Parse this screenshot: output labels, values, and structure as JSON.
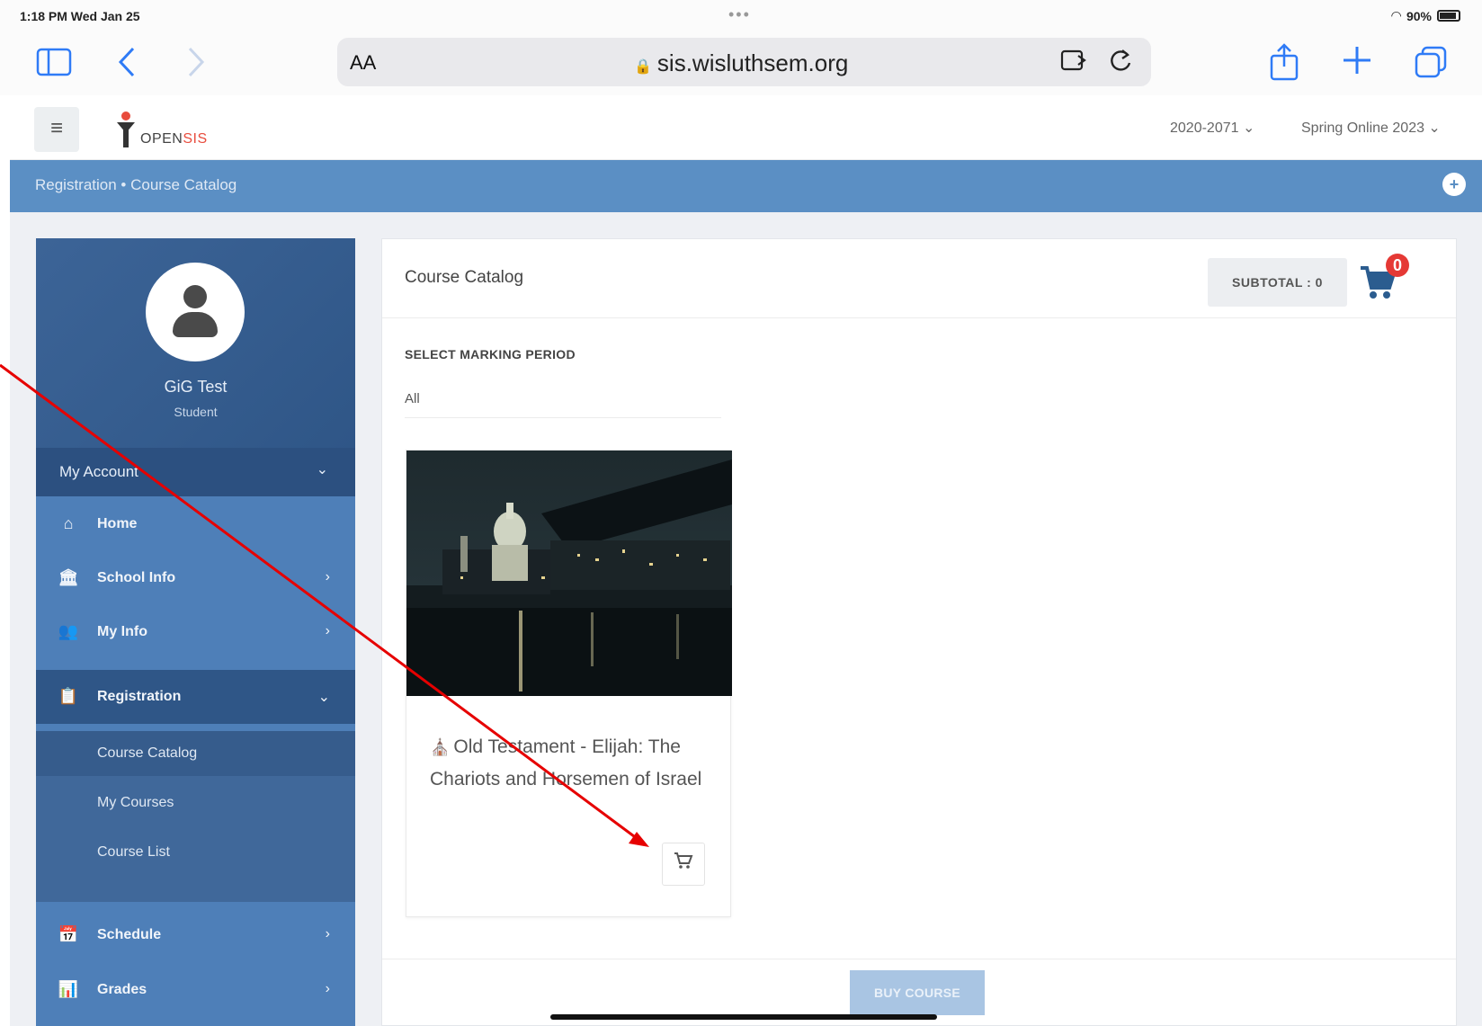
{
  "status_bar": {
    "time": "1:18 PM  Wed Jan 25",
    "dots": "•••",
    "battery": "90%"
  },
  "browser": {
    "aa": "AA",
    "url": "sis.wisluthsem.org",
    "lock": "🔒"
  },
  "header": {
    "logo_text": "OPEN",
    "logo_sis": "SIS",
    "school_year": "2020-2071 ⌄",
    "marking_period": "Spring Online 2023 ⌄"
  },
  "breadcrumb": {
    "text": "Registration  •  Course Catalog"
  },
  "sidebar": {
    "user_name": "GiG Test",
    "user_role": "Student",
    "account_label": "My Account",
    "items": [
      {
        "label": "Home",
        "icon": "home-icon"
      },
      {
        "label": "School Info",
        "icon": "school-icon"
      },
      {
        "label": "My Info",
        "icon": "people-icon"
      },
      {
        "label": "Registration",
        "icon": "clipboard-icon"
      },
      {
        "label": "Schedule",
        "icon": "calendar-icon"
      },
      {
        "label": "Grades",
        "icon": "chart-icon"
      }
    ],
    "sub_items": [
      "Course Catalog",
      "My Courses",
      "Course List"
    ]
  },
  "main": {
    "title": "Course Catalog",
    "subtotal": "SUBTOTAL : 0",
    "cart_count": "0",
    "marking_period_label": "SELECT MARKING PERIOD",
    "marking_period_value": "All",
    "course": {
      "title": "Old Testament - Elijah: The Chariots and Horsemen of Israel"
    },
    "buy_label": "BUY COURSE"
  },
  "colors": {
    "accent": "#5b8fc4",
    "sidebar": "#4e7fb8",
    "badge": "#e53935",
    "annotation": "#e60000"
  }
}
